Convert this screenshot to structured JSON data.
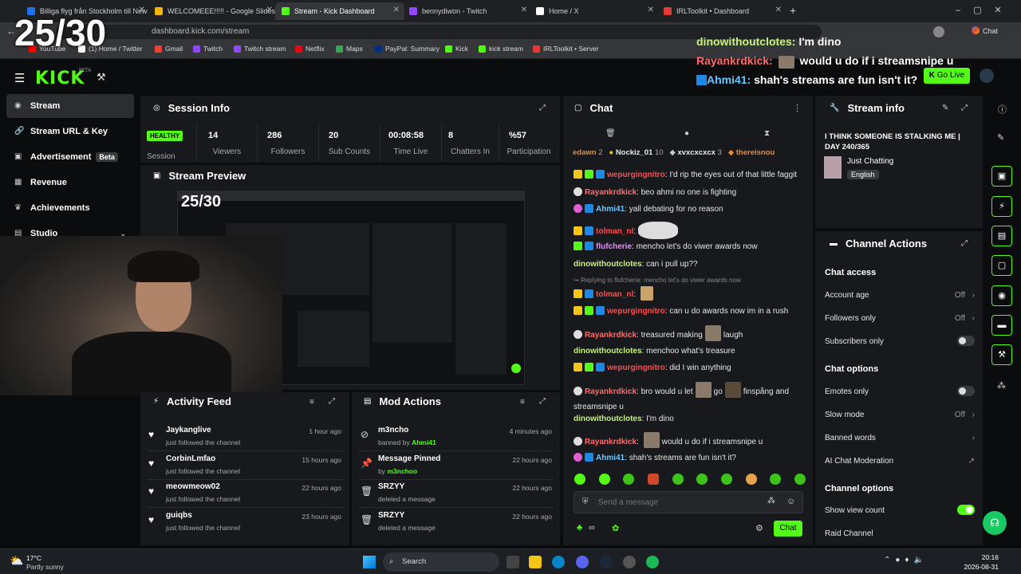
{
  "browser": {
    "tabs": [
      {
        "label": "Billiga flyg från Stockholm till New",
        "color": "#1a73e8"
      },
      {
        "label": "WELCOMEEE!!!!! - Google Slides",
        "color": "#f4b400"
      },
      {
        "label": "Stream - Kick Dashboard",
        "color": "#53fc18"
      },
      {
        "label": "bennydiwon - Twitch",
        "color": "#9146ff"
      },
      {
        "label": "Home / X",
        "color": "#ffffff"
      },
      {
        "label": "IRLToolkit • Dashboard",
        "color": "#e53935"
      }
    ],
    "url": "dashboard.kick.com/stream",
    "profile": "Chat",
    "bookmarks": [
      "YouTube",
      "(1) Home / Twitter",
      "Gmail",
      "Twitch",
      "Twitch stream",
      "Netflix",
      "Maps",
      "PayPal: Summary",
      "Kick",
      "kick stream",
      "IRLToolkit • Server"
    ]
  },
  "counter": "25/30",
  "kick": {
    "beta": "BETA",
    "go_live": "Go Live"
  },
  "overlay_chat": [
    {
      "user": "dinowithoutclotes:",
      "text": "I'm dino",
      "color": "#c6f27c"
    },
    {
      "user": "Rayankrdkick:",
      "text": "would u do if i streamsnipe u",
      "color": "#ff6b6b"
    },
    {
      "user": "Ahmi41:",
      "text": "shah's streams are fun isn't it?",
      "color": "#6ec6ff"
    }
  ],
  "sidebar": {
    "items": [
      {
        "label": "Stream",
        "icon": "stream-icon"
      },
      {
        "label": "Stream URL & Key",
        "icon": "link-icon"
      },
      {
        "label": "Advertisement",
        "icon": "ad-icon",
        "badge": "Beta"
      },
      {
        "label": "Revenue",
        "icon": "revenue-icon"
      },
      {
        "label": "Achievements",
        "icon": "trophy-icon"
      },
      {
        "label": "Studio",
        "icon": "studio-icon"
      }
    ]
  },
  "session": {
    "title": "Session Info",
    "status": "HEALTHY",
    "status_label": "Session",
    "stats": [
      {
        "value": "14",
        "label": "Viewers"
      },
      {
        "value": "286",
        "label": "Followers"
      },
      {
        "value": "20",
        "label": "Sub Counts"
      },
      {
        "value": "00:08:58",
        "label": "Time Live"
      },
      {
        "value": "8",
        "label": "Chatters In"
      },
      {
        "value": "%57",
        "label": "Participation"
      }
    ]
  },
  "preview": {
    "title": "Stream Preview",
    "counter": "25/30"
  },
  "activity": {
    "title": "Activity Feed",
    "items": [
      {
        "name": "Jaykanglive",
        "sub": "just followed the channel",
        "time": "1 hour ago"
      },
      {
        "name": "CorbinLmfao",
        "sub": "just followed the channel",
        "time": "15 hours ago"
      },
      {
        "name": "meowmeow02",
        "sub": "just followed the channel",
        "time": "22 hours ago"
      },
      {
        "name": "guiqbs",
        "sub": "just followed the channel",
        "time": "23 hours ago"
      }
    ]
  },
  "mod": {
    "title": "Mod Actions",
    "items": [
      {
        "name": "m3ncho",
        "sub": "banned by",
        "by": "Ahmi41",
        "time": "4 minutes ago",
        "icon": "ban-icon"
      },
      {
        "name": "Message Pinned",
        "sub": "by",
        "by": "m3nchoo",
        "time": "22 hours ago",
        "icon": "pin-icon"
      },
      {
        "name": "SRZYY",
        "sub": "deleted a message",
        "by": "",
        "time": "22 hours ago",
        "icon": "trash-icon"
      },
      {
        "name": "SRZYY",
        "sub": "deleted a message",
        "by": "",
        "time": "22 hours ago",
        "icon": "trash-icon"
      }
    ]
  },
  "chat": {
    "title": "Chat",
    "placeholder": "Send a message",
    "send": "Chat",
    "leaderboard": [
      {
        "name": "edawn",
        "n": "2"
      },
      {
        "name": "Nockiz_01",
        "n": "10"
      },
      {
        "name": "xvxcxcxcx",
        "n": "3"
      },
      {
        "name": "thereisnou",
        "n": ""
      }
    ],
    "messages": [
      {
        "user": "wepurgingnitro",
        "text": "I'd rip the eyes out of that little faggit",
        "color": "#ff4d4d"
      },
      {
        "user": "Rayankrdkick",
        "text": "beo ahmi no one is fighting",
        "color": "#ff6b6b"
      },
      {
        "user": "Ahmi41",
        "text": "yall debating for no reason",
        "color": "#6ec6ff"
      },
      {
        "user": "tolman_nl",
        "text": "",
        "color": "#ff4d4d"
      },
      {
        "user": "flufcherie",
        "text": "mencho let's do viwer awards now",
        "color": "#e88bff"
      },
      {
        "user": "dinowithoutclotes",
        "text": "can i pull up??",
        "color": "#c6f27c"
      },
      {
        "user": "",
        "text": "Replying to flufcherie: mencho let's do viwer awards now",
        "color": "#888"
      },
      {
        "user": "tolman_nl",
        "text": "",
        "color": "#ff4d4d"
      },
      {
        "user": "wepurgingnitro",
        "text": "can u do awards now im in a rush",
        "color": "#ff4d4d"
      },
      {
        "user": "Rayankrdkick",
        "text": "treasured making",
        "text2": "laugh",
        "color": "#ff6b6b"
      },
      {
        "user": "dinowithoutclotes",
        "text": "menchoo what's treasure",
        "color": "#c6f27c"
      },
      {
        "user": "wepurgingnitro",
        "text": "did I win anything",
        "color": "#ff4d4d"
      },
      {
        "user": "Rayankrdkick",
        "text": "bro would u let",
        "text2": "go",
        "text3": "finspång and streamsnipe u",
        "color": "#ff6b6b"
      },
      {
        "user": "dinowithoutclotes",
        "text": "I'm dino",
        "color": "#c6f27c"
      },
      {
        "user": "Rayankrdkick",
        "text": "would u do if i streamsnipe u",
        "color": "#ff6b6b"
      },
      {
        "user": "Ahmi41",
        "text": "shah's streams are fun isn't it?",
        "color": "#6ec6ff"
      }
    ]
  },
  "stream_info": {
    "title": "Stream info",
    "stream_title": "I THINK SOMEONE IS STALKING ME | DAY 240/365",
    "category": "Just Chatting",
    "language": "English"
  },
  "channel_actions": {
    "title": "Channel Actions",
    "chat_access": "Chat access",
    "rows_access": [
      {
        "label": "Account age",
        "value": "Off"
      },
      {
        "label": "Followers only",
        "value": "Off"
      },
      {
        "label": "Subscribers only",
        "value": ""
      }
    ],
    "chat_options": "Chat options",
    "rows_options": [
      {
        "label": "Emotes only",
        "value": ""
      },
      {
        "label": "Slow mode",
        "value": "Off"
      },
      {
        "label": "Banned words",
        "value": ""
      },
      {
        "label": "AI Chat Moderation",
        "value": ""
      }
    ],
    "channel_options": "Channel options",
    "rows_channel": [
      {
        "label": "Show view count",
        "value": ""
      },
      {
        "label": "Raid Channel",
        "value": ""
      }
    ]
  },
  "taskbar": {
    "temp": "17°C",
    "weather": "Partly sunny",
    "search": "Search",
    "time": "20:16",
    "date": "2026-08-31"
  }
}
